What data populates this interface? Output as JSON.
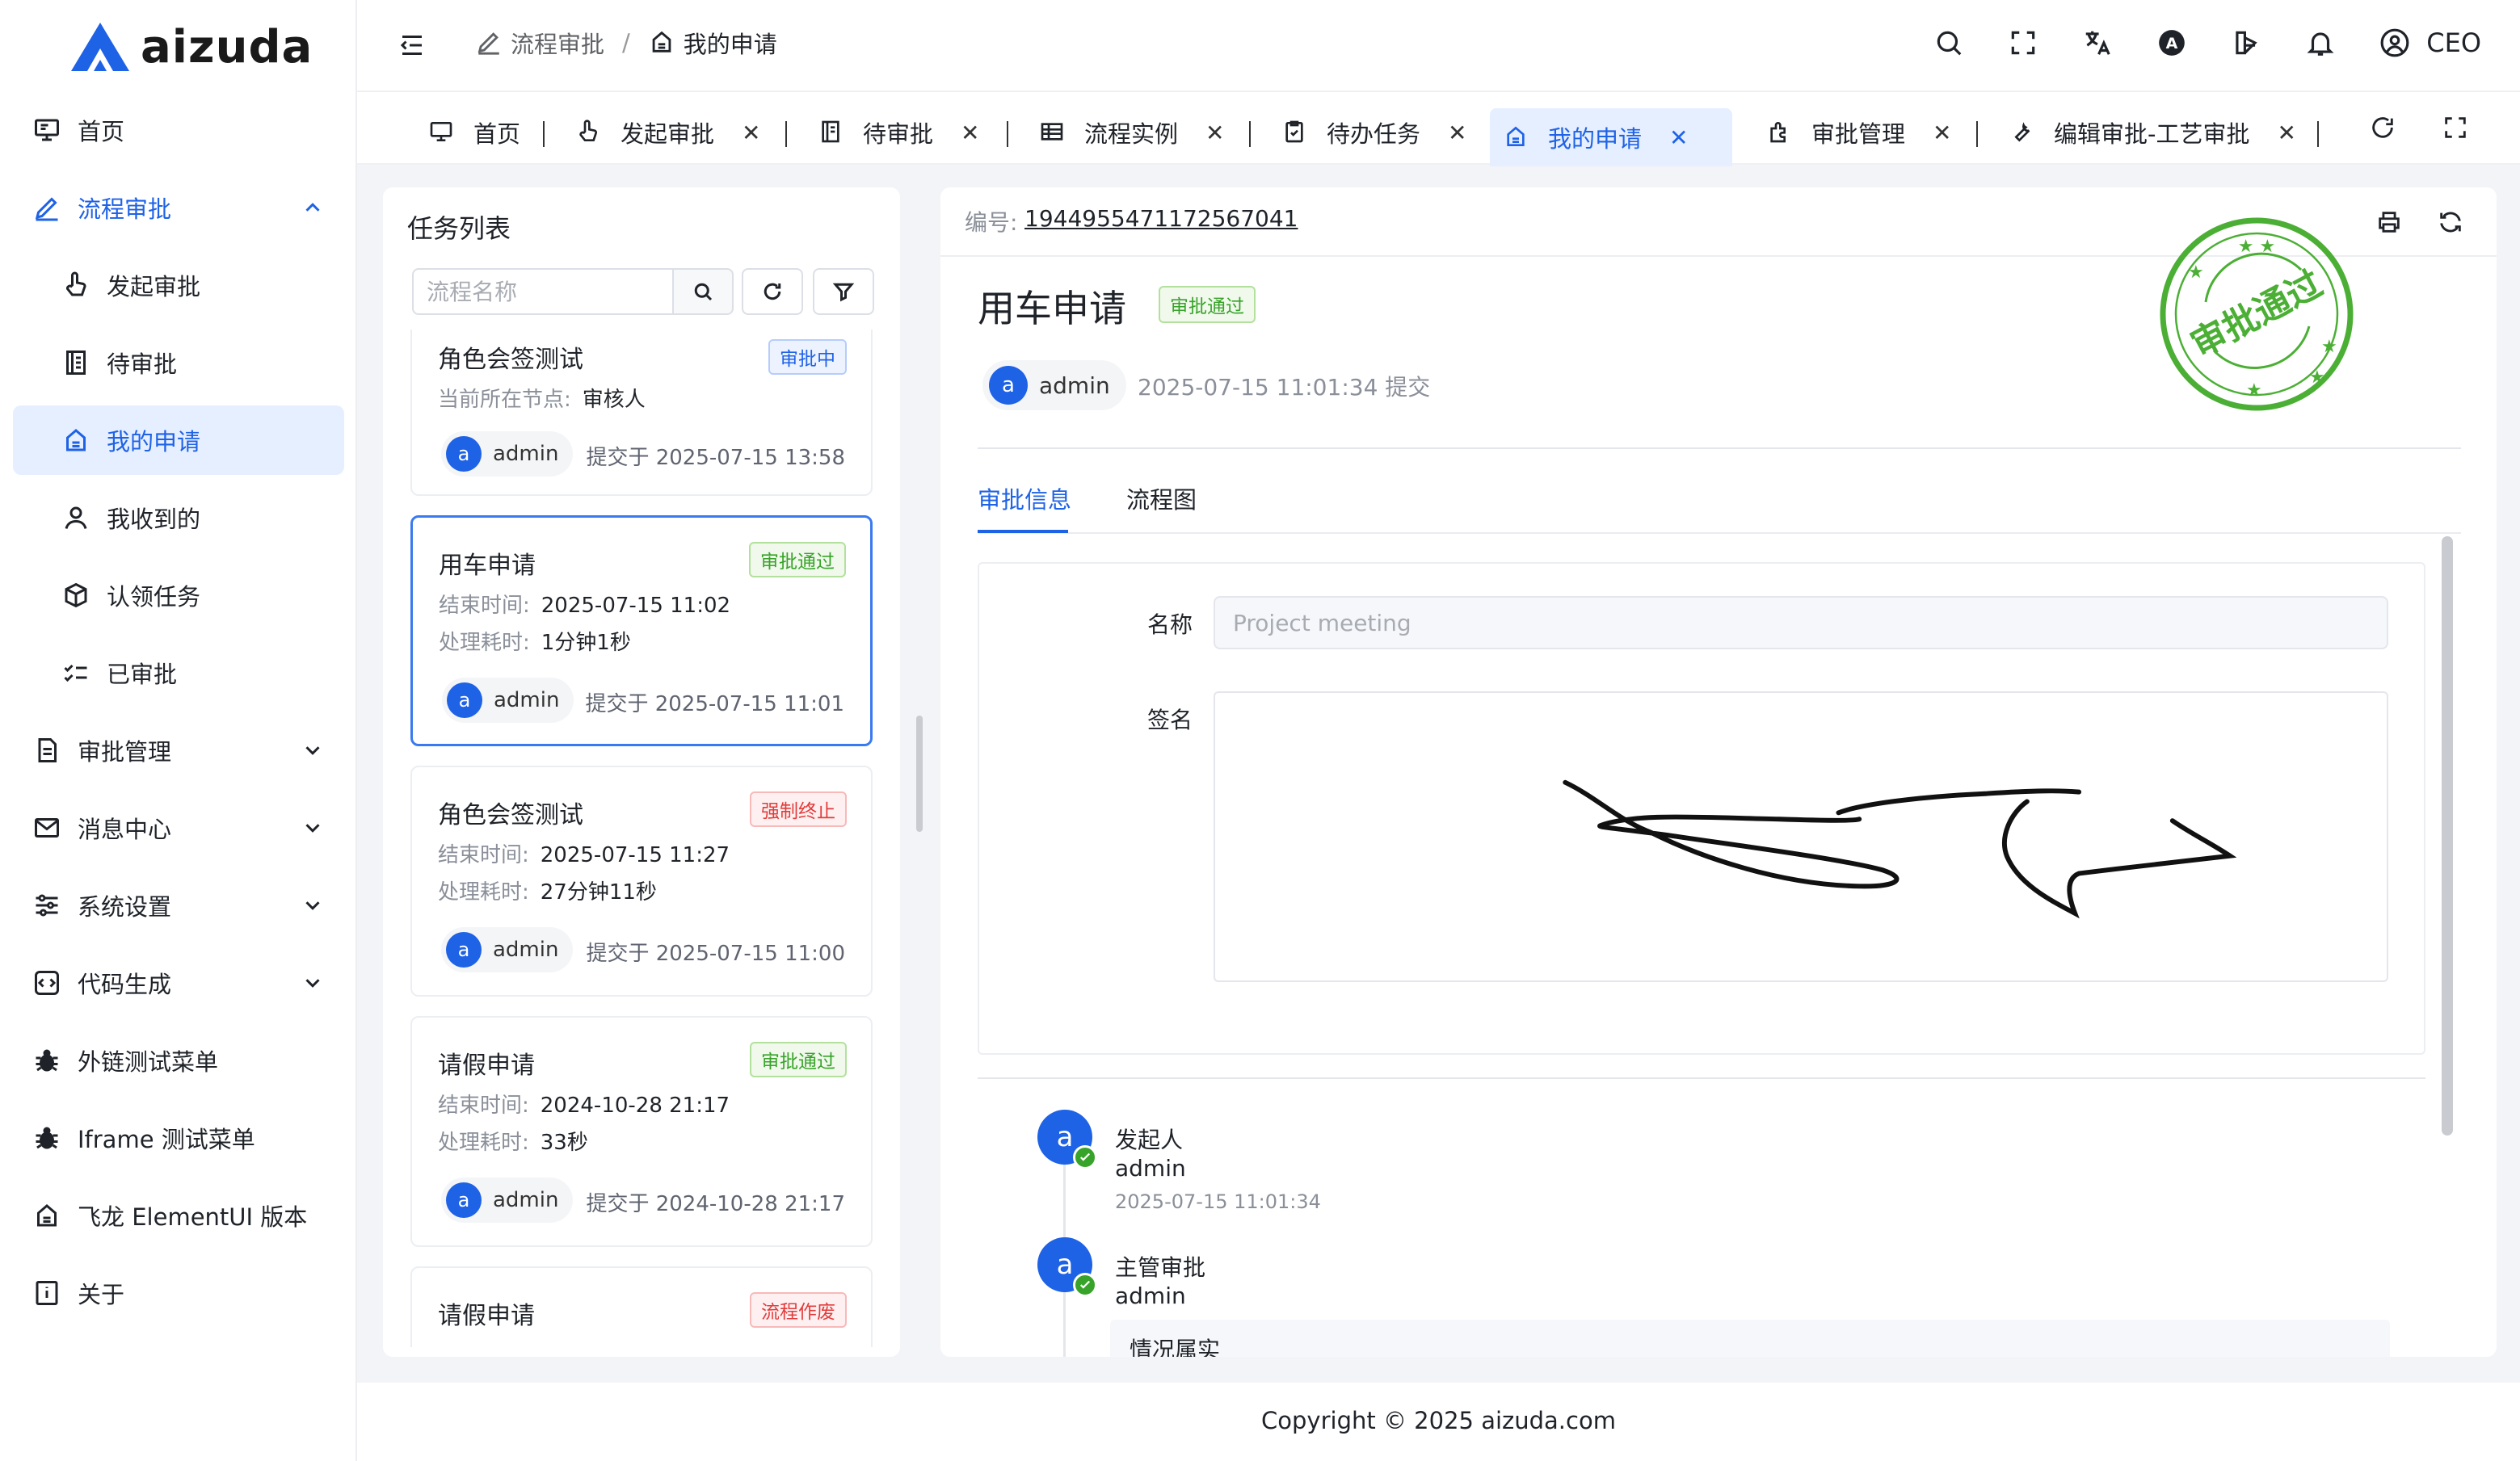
{
  "brand": {
    "name": "aizuda"
  },
  "sidebar": {
    "items": [
      {
        "label": "首页"
      },
      {
        "label": "流程审批"
      },
      {
        "label": "发起审批"
      },
      {
        "label": "待审批"
      },
      {
        "label": "我的申请"
      },
      {
        "label": "我收到的"
      },
      {
        "label": "认领任务"
      },
      {
        "label": "已审批"
      },
      {
        "label": "审批管理"
      },
      {
        "label": "消息中心"
      },
      {
        "label": "系统设置"
      },
      {
        "label": "代码生成"
      },
      {
        "label": "外链测试菜单"
      },
      {
        "label": "Iframe 测试菜单"
      },
      {
        "label": "飞龙 ElementUI 版本"
      },
      {
        "label": "关于"
      }
    ]
  },
  "header": {
    "breadcrumb": [
      "流程审批",
      "我的申请"
    ],
    "separator": "/",
    "user": "CEO",
    "avatar_letter": "A"
  },
  "tabs": [
    {
      "label": "首页"
    },
    {
      "label": "发起审批"
    },
    {
      "label": "待审批"
    },
    {
      "label": "流程实例"
    },
    {
      "label": "待办任务"
    },
    {
      "label": "我的申请"
    },
    {
      "label": "审批管理"
    },
    {
      "label": "编辑审批-工艺审批"
    }
  ],
  "task_list": {
    "title": "任务列表",
    "search_placeholder": "流程名称",
    "cards": [
      {
        "title": "角色会签测试",
        "status": "审批中",
        "row1_label": "当前所在节点:",
        "row1_value": "审核人",
        "user": "admin",
        "avatar": "a",
        "submitted": "提交于 2025-07-15 13:58"
      },
      {
        "title": "用车申请",
        "status": "审批通过",
        "row1_label": "结束时间:",
        "row1_value": "2025-07-15 11:02",
        "row2_label": "处理耗时:",
        "row2_value": "1分钟1秒",
        "user": "admin",
        "avatar": "a",
        "submitted": "提交于 2025-07-15 11:01"
      },
      {
        "title": "角色会签测试",
        "status": "强制终止",
        "row1_label": "结束时间:",
        "row1_value": "2025-07-15 11:27",
        "row2_label": "处理耗时:",
        "row2_value": "27分钟11秒",
        "user": "admin",
        "avatar": "a",
        "submitted": "提交于 2025-07-15 11:00"
      },
      {
        "title": "请假申请",
        "status": "审批通过",
        "row1_label": "结束时间:",
        "row1_value": "2024-10-28 21:17",
        "row2_label": "处理耗时:",
        "row2_value": "33秒",
        "user": "admin",
        "avatar": "a",
        "submitted": "提交于 2024-10-28 21:17"
      },
      {
        "title": "请假申请",
        "status": "流程作废"
      }
    ]
  },
  "detail": {
    "no_label": "编号:",
    "no_value": "1944955471172567041",
    "title": "用车申请",
    "status": "审批通过",
    "user": "admin",
    "avatar": "a",
    "submitted": "2025-07-15 11:01:34 提交",
    "stamp_text": "审批通过",
    "tabs": [
      "审批信息",
      "流程图"
    ],
    "form": {
      "name_label": "名称",
      "name_value": "Project meeting",
      "sign_label": "签名"
    },
    "timeline": [
      {
        "role": "发起人",
        "name": "admin",
        "time": "2025-07-15 11:01:34",
        "avatar": "a"
      },
      {
        "role": "主管审批",
        "name": "admin",
        "avatar": "a",
        "comment": "情况属实"
      }
    ]
  },
  "colors": {
    "primary": "#1e62e6",
    "success": "#38a32a",
    "danger": "#e23c3c",
    "stamp": "#4caf35"
  },
  "footer": {
    "copyright": "Copyright © 2025 aizuda.com"
  }
}
